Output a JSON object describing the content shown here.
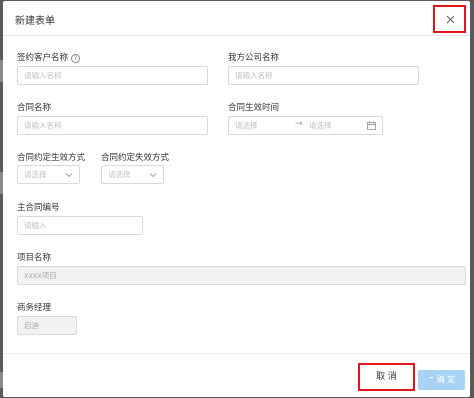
{
  "dialog": {
    "title": "新建表单",
    "close_icon": "close-icon"
  },
  "form": {
    "customer_name": {
      "label": "签约客户名称",
      "placeholder": "请输入名称",
      "help_icon": "question-circle-icon"
    },
    "company_name": {
      "label": "我方公司名称",
      "placeholder": "请输入名称"
    },
    "contract_name": {
      "label": "合同名称",
      "placeholder": "请输入名称"
    },
    "effective_time": {
      "label": "合同生效时间",
      "start_placeholder": "请选择",
      "end_placeholder": "请选择",
      "separator": "→",
      "icon": "calendar-icon"
    },
    "effective_mode": {
      "label": "合同约定生效方式",
      "value": "请选择",
      "icon": "chevron-down-icon"
    },
    "expire_mode": {
      "label": "合同约定失效方式",
      "value": "请选择",
      "icon": "chevron-down-icon"
    },
    "main_contract_no": {
      "label": "主合同编号",
      "placeholder": "请输入"
    },
    "project_name": {
      "label": "项目名称",
      "value": "xxxx项目"
    },
    "business_manager": {
      "label": "商务经理",
      "value": "启迪"
    }
  },
  "footer": {
    "cancel_label": "取 消",
    "ok_label": "确 定"
  }
}
